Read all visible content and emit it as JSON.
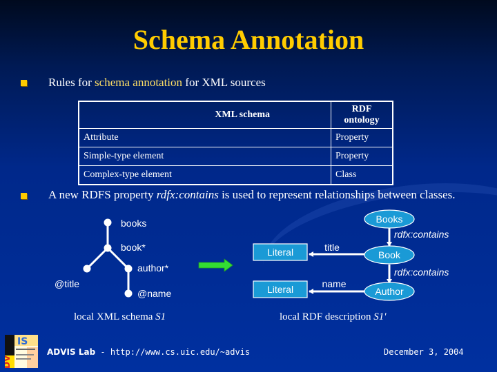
{
  "slide": {
    "title": "Schema Annotation",
    "bullets": [
      {
        "pre": "Rules for ",
        "highlight": "schema annotation",
        "post": " for XML sources"
      },
      {
        "pre": "A new RDFS property ",
        "italic": "rdfx:contains",
        "post": " is used to represent relationships between classes."
      }
    ],
    "colors": {
      "title": "#ffcc00",
      "bullet": "#ffcc00",
      "node_fill": "#1a9ad6",
      "arrow_green": "#33dd33"
    }
  },
  "table": {
    "headers": [
      "XML schema",
      "RDF ontology"
    ],
    "rows": [
      [
        "Attribute",
        "Property"
      ],
      [
        "Simple-type element",
        "Property"
      ],
      [
        "Complex-type element",
        "Class"
      ]
    ]
  },
  "xml_tree": {
    "nodes": {
      "books": "books",
      "book": "book*",
      "author": "author*",
      "title": "@title",
      "name": "@name"
    },
    "caption_pre": "local XML schema ",
    "caption_italic": "S1"
  },
  "rdf_graph": {
    "classes": [
      "Books",
      "Book",
      "Author"
    ],
    "literals": [
      "Literal",
      "Literal"
    ],
    "edges": {
      "contains1": "rdfx:contains",
      "contains2": "rdfx:contains",
      "title": "title",
      "name": "name"
    },
    "caption_pre": "local RDF description ",
    "caption_italic": "S1'"
  },
  "footer": {
    "lab": "ADVIS Lab",
    "separator": " - ",
    "url": "http://www.cs.uic.edu/~advis",
    "date": "December 3, 2004",
    "logo_letters_left": "ADV",
    "logo_letters_right": "IS"
  }
}
